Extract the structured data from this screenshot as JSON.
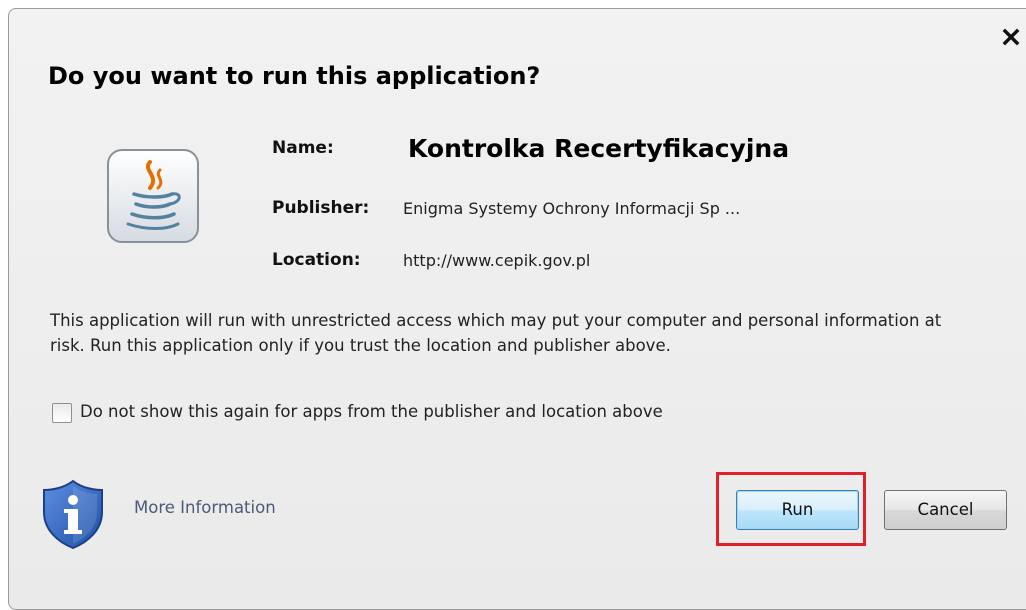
{
  "dialog": {
    "title": "Do you want to run this application?",
    "close_icon": "close-icon"
  },
  "app_icon": "java-icon",
  "details": {
    "name_label": "Name:",
    "name_value": "Kontrolka Recertyfikacyjna",
    "publisher_label": "Publisher:",
    "publisher_value": "Enigma Systemy Ochrony Informacji Sp ...",
    "location_label": "Location:",
    "location_value": "http://www.cepik.gov.pl"
  },
  "warning_text": "This application will run with unrestricted access which may put your computer and personal information at risk. Run this application only if you trust the location and publisher above.",
  "checkbox": {
    "label": "Do not show this again for apps from the publisher and location above",
    "checked": false
  },
  "footer": {
    "info_icon": "shield-info-icon",
    "more_info_label": "More Information",
    "run_label": "Run",
    "cancel_label": "Cancel",
    "highlight_color": "#e0202a"
  }
}
